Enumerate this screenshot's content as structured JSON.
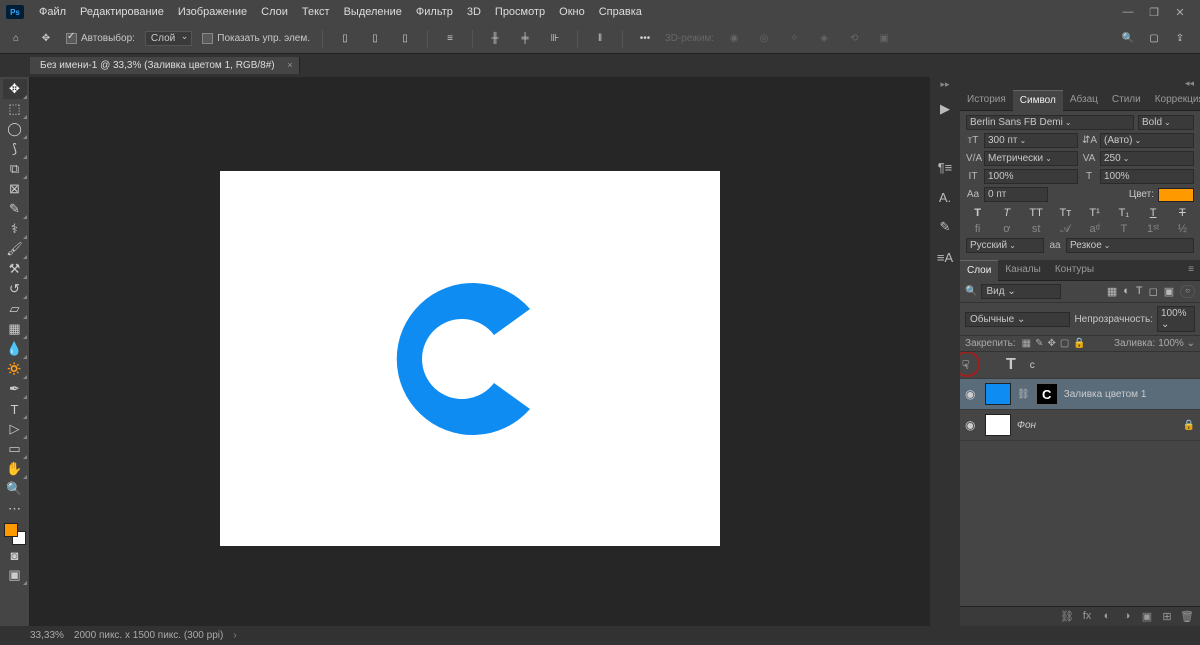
{
  "menubar": [
    "Файл",
    "Редактирование",
    "Изображение",
    "Слои",
    "Текст",
    "Выделение",
    "Фильтр",
    "3D",
    "Просмотр",
    "Окно",
    "Справка"
  ],
  "optbar": {
    "auto_select_label": "Автовыбор:",
    "auto_select_dropdown": "Слой",
    "show_controls": "Показать упр. элем.",
    "mode3d": "3D-режим:"
  },
  "tab": {
    "title": "Без имени-1 @ 33,3% (Заливка цветом 1, RGB/8#)"
  },
  "panels": {
    "tabs_top": [
      "История",
      "Символ",
      "Абзац",
      "Стили",
      "Коррекция"
    ],
    "font_family": "Berlin Sans FB Demi",
    "font_style": "Bold",
    "font_size": "300 пт",
    "leading": "(Авто)",
    "kerning": "Метрически",
    "tracking": "250",
    "vscale": "100%",
    "hscale": "100%",
    "baseline": "0 пт",
    "color_label": "Цвет:",
    "color_value": "#ff9900",
    "language": "Русский",
    "aa_label": "aa",
    "aa": "Резкое",
    "tabs_layers": [
      "Слои",
      "Каналы",
      "Контуры"
    ],
    "kind_filter": "Вид",
    "blend_mode": "Обычные",
    "opacity_label": "Непрозрачность:",
    "opacity_value": "100%",
    "lock_label": "Закрепить:",
    "fill_label": "Заливка:",
    "fill_value": "100%",
    "layers": [
      {
        "type": "text",
        "name": "c",
        "visible": false,
        "indented": true
      },
      {
        "type": "fill",
        "name": "Заливка цветом 1",
        "visible": true,
        "active": true,
        "fill_color": "#0e8cf2",
        "mask_letter": "C"
      },
      {
        "type": "bg",
        "name": "Фон",
        "visible": true,
        "locked": true
      }
    ]
  },
  "status": {
    "zoom": "33,33%",
    "doc": "2000 пикс. x 1500 пикс. (300 ppi)"
  },
  "canvas_letter": {
    "color": "#0e8cf2"
  }
}
